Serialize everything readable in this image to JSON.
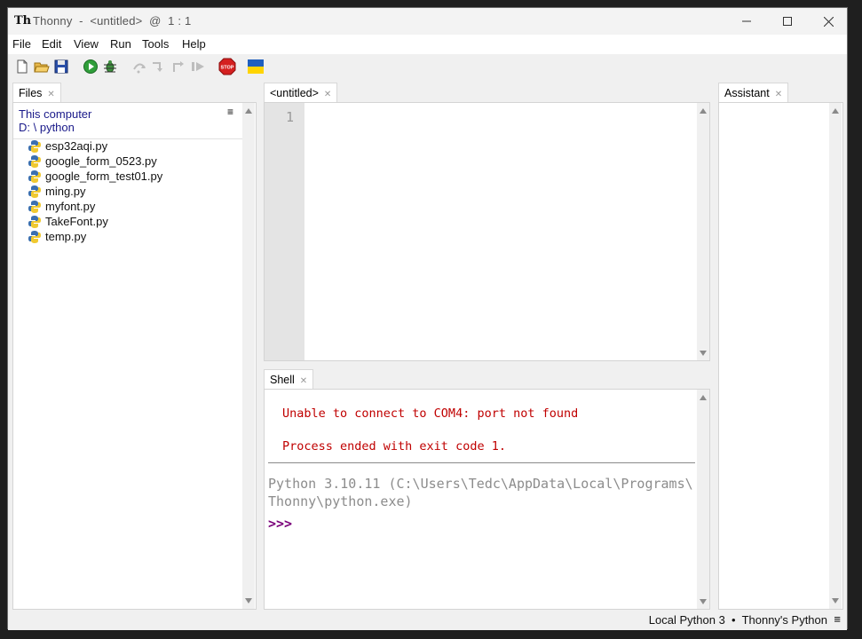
{
  "window": {
    "title": "Thonny  -  <untitled>  @  1 : 1",
    "minimize_icon": "minimize-icon",
    "maximize_icon": "maximize-icon",
    "close_icon": "close-icon"
  },
  "menu": [
    "File",
    "Edit",
    "View",
    "Run",
    "Tools",
    "Help"
  ],
  "toolbar": {
    "icons": [
      "new-file-icon",
      "open-folder-icon",
      "save-icon",
      "run-icon",
      "debug-icon",
      "step-over-icon",
      "step-into-icon",
      "step-out-icon",
      "resume-icon",
      "stop-icon",
      "ukraine-flag-icon"
    ],
    "stop_label": "STOP"
  },
  "files": {
    "tab": "Files",
    "location": "This computer",
    "path": "D: \\ python",
    "items": [
      "esp32aqi.py",
      "google_form_0523.py",
      "google_form_test01.py",
      "ming.py",
      "myfont.py",
      "TakeFont.py",
      "temp.py"
    ]
  },
  "editor": {
    "tab": "<untitled>",
    "line_numbers": [
      "1"
    ]
  },
  "shell": {
    "tab": "Shell",
    "error_line1": "Unable to connect to COM4: port not found",
    "error_line2": "Process ended with exit code 1.",
    "python_info_line1": "Python 3.10.11 (C:\\Users\\Tedc\\AppData\\Local\\Programs\\",
    "python_info_line2": "Thonny\\python.exe)",
    "prompt": ">>>"
  },
  "assistant": {
    "tab": "Assistant"
  },
  "status": {
    "interpreter": "Local Python 3  •  Thonny's Python",
    "menu_icon": "hamburger-icon"
  },
  "colors": {
    "error_red": "#c00000",
    "info_gray": "#8c8c8c",
    "prompt_purple": "#7a007a",
    "path_blue": "#1a1a8a"
  }
}
